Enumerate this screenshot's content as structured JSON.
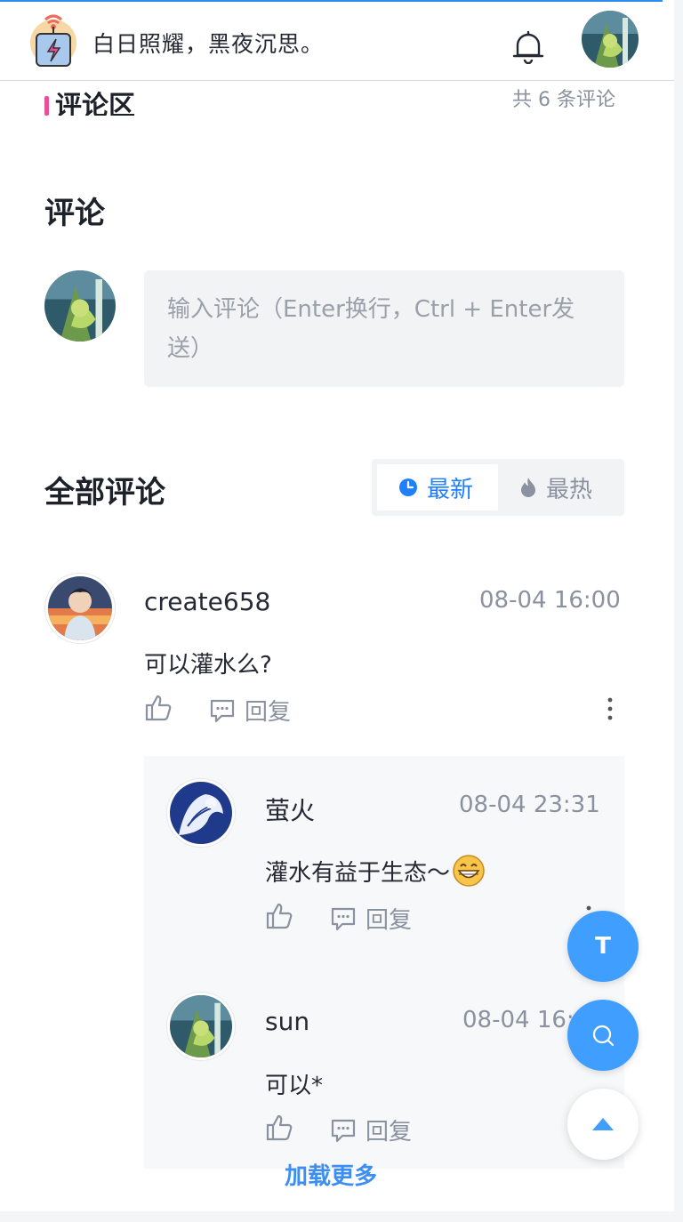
{
  "header": {
    "slogan": "白日照耀，黑夜沉思。"
  },
  "section": {
    "title": "评论区",
    "count_text": "共 6 条评论"
  },
  "comment_form": {
    "heading": "评论",
    "placeholder": "输入评论（Enter换行，Ctrl + Enter发送）"
  },
  "list": {
    "heading": "全部评论",
    "sort_latest": "最新",
    "sort_hot": "最热"
  },
  "comments": [
    {
      "name": "create658",
      "time": "08-04 16:00",
      "text": "可以灌水么?",
      "reply_label": "回复"
    }
  ],
  "replies": [
    {
      "name": "萤火",
      "time": "08-04 23:31",
      "text": "灌水有益于生态～",
      "reply_label": "回复"
    },
    {
      "name": "sun",
      "time": "08-04 16:00",
      "text": "可以*",
      "reply_label": "回复"
    }
  ],
  "load_more": "加载更多",
  "fab": {
    "theme_label": "T"
  },
  "colors": {
    "accent": "#1e80ff",
    "fab_blue": "#409eff",
    "section_bar": "#e8509a"
  }
}
